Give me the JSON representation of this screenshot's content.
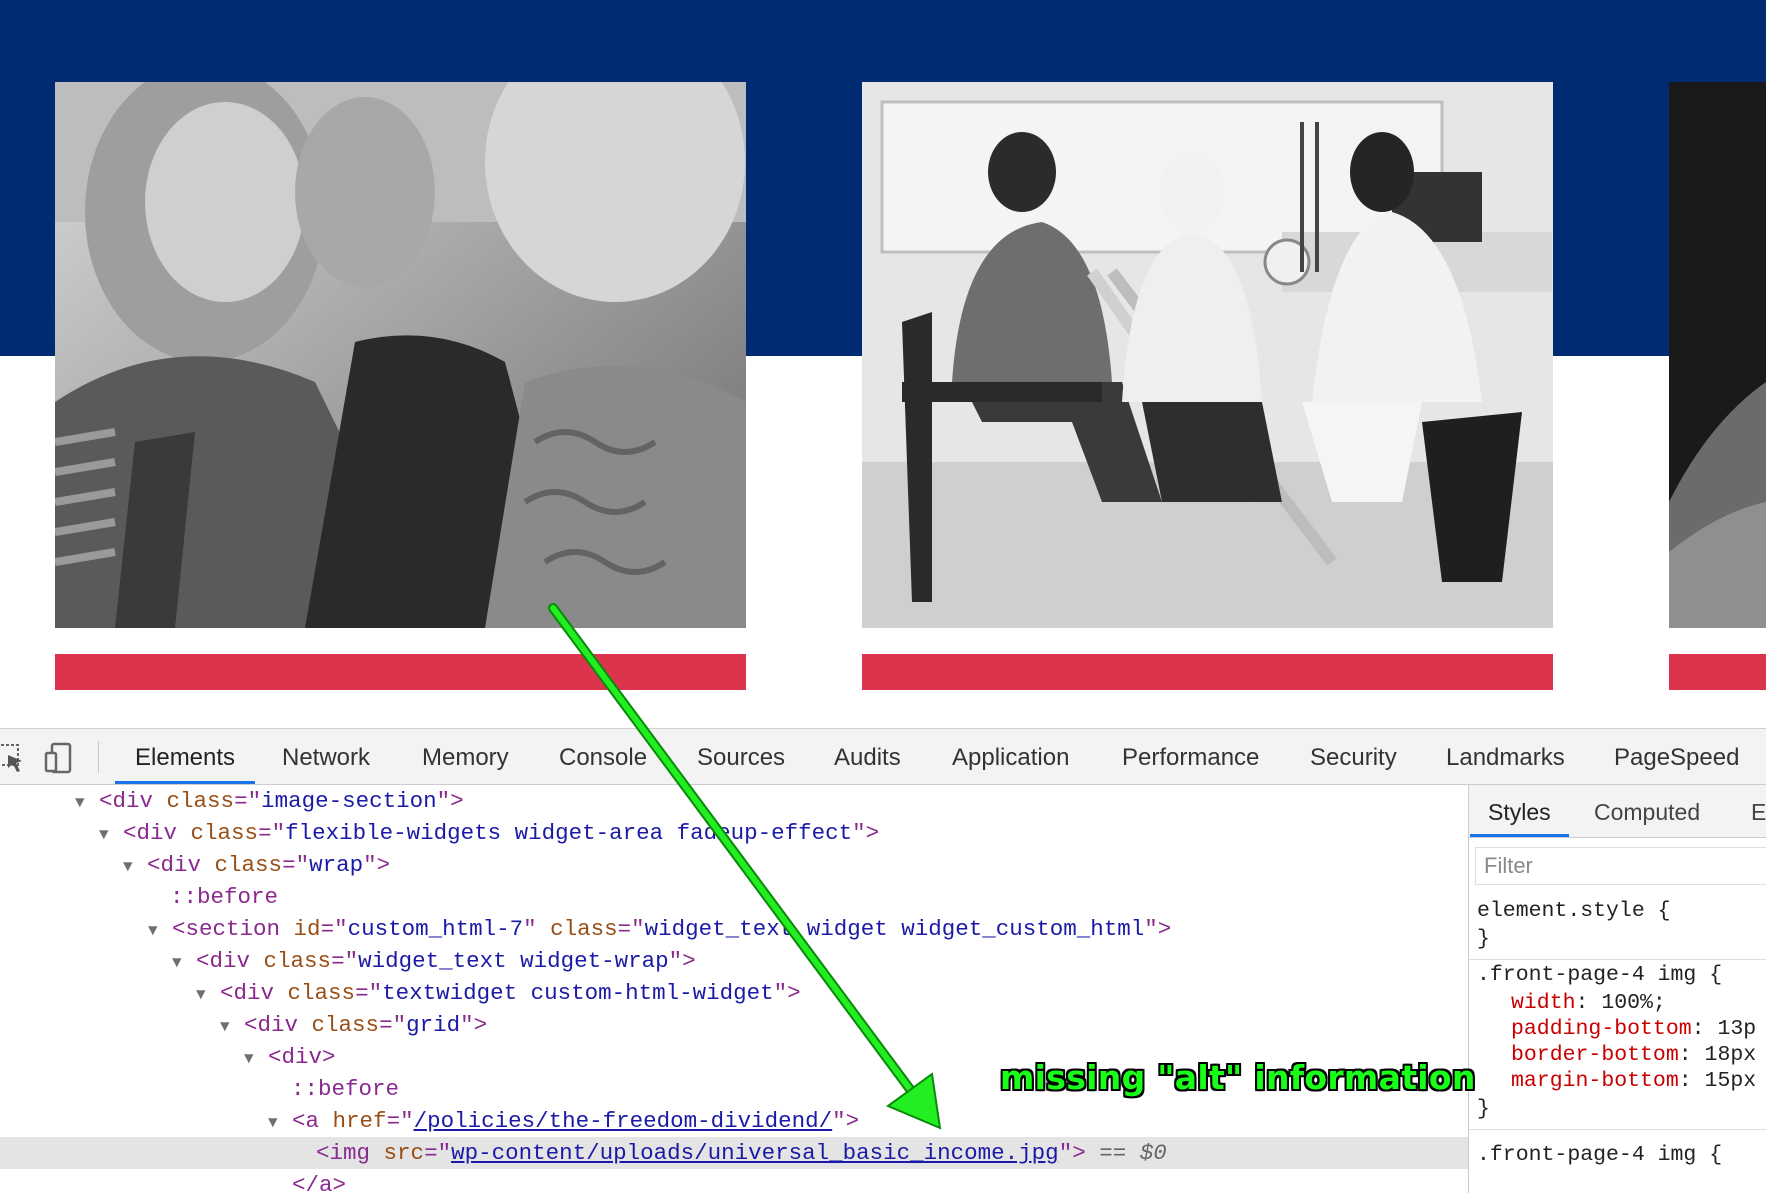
{
  "devtools": {
    "tabs": [
      {
        "label": "Elements"
      },
      {
        "label": "Network"
      },
      {
        "label": "Memory"
      },
      {
        "label": "Console"
      },
      {
        "label": "Sources"
      },
      {
        "label": "Audits"
      },
      {
        "label": "Application"
      },
      {
        "label": "Performance"
      },
      {
        "label": "Security"
      },
      {
        "label": "Landmarks"
      },
      {
        "label": "PageSpeed"
      }
    ],
    "active_tab": "Elements",
    "tree": {
      "l1": {
        "tag": "div",
        "attr": "class",
        "val": "image-section"
      },
      "l2": {
        "tag": "div",
        "attr": "class",
        "val": "flexible-widgets widget-area fadeup-effect"
      },
      "l3": {
        "tag": "div",
        "attr": "class",
        "val": "wrap"
      },
      "l4": {
        "pseudo": "::before"
      },
      "l5": {
        "tag": "section",
        "attr1": "id",
        "val1": "custom_html-7",
        "attr2": "class",
        "val2": "widget_text widget widget_custom_html"
      },
      "l6": {
        "tag": "div",
        "attr": "class",
        "val": "widget_text widget-wrap"
      },
      "l7": {
        "tag": "div",
        "attr": "class",
        "val": "textwidget custom-html-widget"
      },
      "l8": {
        "tag": "div",
        "attr": "class",
        "val": "grid"
      },
      "l9": {
        "tag": "div"
      },
      "l10": {
        "pseudo": "::before"
      },
      "l11": {
        "tag": "a",
        "attr": "href",
        "val": "/policies/the-freedom-dividend/"
      },
      "l12": {
        "tag": "img",
        "attr": "src",
        "val": "wp-content/uploads/universal_basic_income.jpg",
        "suffix": "== $0"
      },
      "l13": {
        "tag": "/a"
      }
    },
    "styles_panel": {
      "tabs": [
        "Styles",
        "Computed",
        "E"
      ],
      "filter_placeholder": "Filter",
      "rule1": {
        "selector": "element.style {",
        "close": "}"
      },
      "rule2": {
        "selector": ".front-page-4 img {",
        "props": [
          {
            "name": "width",
            "value": "100%;"
          },
          {
            "name": "padding-bottom",
            "value": "13p"
          },
          {
            "name": "border-bottom",
            "value": "18px"
          },
          {
            "name": "margin-bottom",
            "value": "15px"
          }
        ],
        "close": "}"
      },
      "rule3": {
        "selector": ".front-page-4 img {"
      }
    }
  },
  "annotation": {
    "text": "missing \"alt\" information",
    "color": "#18ff18"
  },
  "colors": {
    "site_blue": "#002b73",
    "red_bar": "#dc344d",
    "selection_bg": "#e4e4e4",
    "tab_underline": "#1a73e8"
  }
}
